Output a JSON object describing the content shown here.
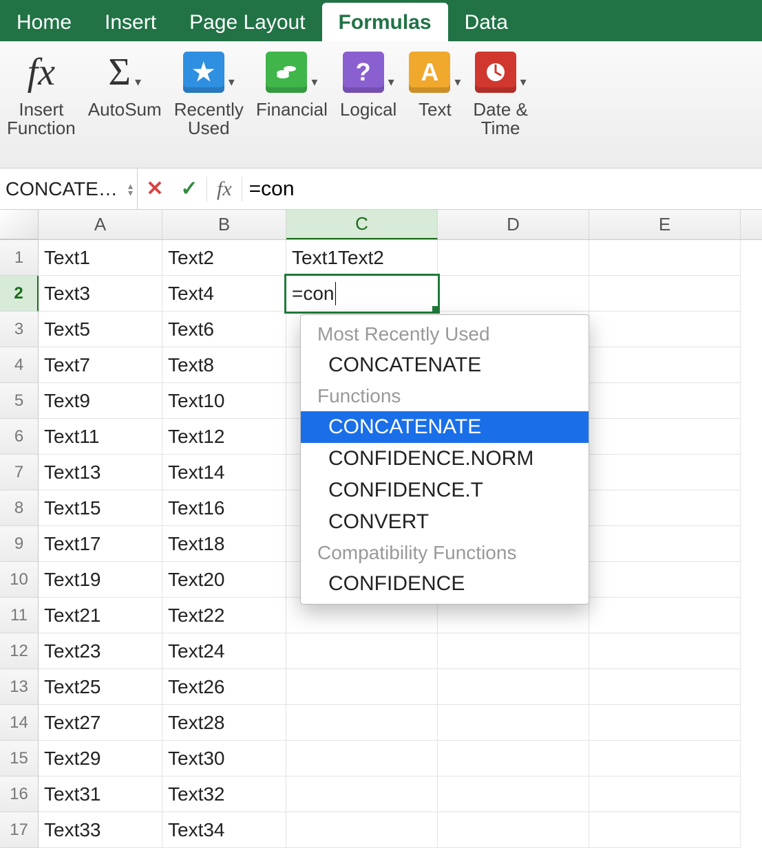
{
  "tabs": {
    "home": "Home",
    "insert": "Insert",
    "pageLayout": "Page Layout",
    "formulas": "Formulas",
    "data": "Data"
  },
  "ribbon": {
    "insertFunction": "Insert\nFunction",
    "autoSum": "AutoSum",
    "recentlyUsed": "Recently\nUsed",
    "financial": "Financial",
    "logical": "Logical",
    "text": "Text",
    "dateTime": "Date &\nTime"
  },
  "nameBox": "CONCATE…",
  "formulaInput": "=con",
  "columns": [
    "A",
    "B",
    "C",
    "D",
    "E"
  ],
  "rows": [
    {
      "n": "1",
      "a": "Text1",
      "b": "Text2",
      "c": "Text1Text2"
    },
    {
      "n": "2",
      "a": "Text3",
      "b": "Text4",
      "c": "=con"
    },
    {
      "n": "3",
      "a": "Text5",
      "b": "Text6",
      "c": ""
    },
    {
      "n": "4",
      "a": "Text7",
      "b": "Text8",
      "c": ""
    },
    {
      "n": "5",
      "a": "Text9",
      "b": "Text10",
      "c": ""
    },
    {
      "n": "6",
      "a": "Text11",
      "b": "Text12",
      "c": ""
    },
    {
      "n": "7",
      "a": "Text13",
      "b": "Text14",
      "c": ""
    },
    {
      "n": "8",
      "a": "Text15",
      "b": "Text16",
      "c": ""
    },
    {
      "n": "9",
      "a": "Text17",
      "b": "Text18",
      "c": ""
    },
    {
      "n": "10",
      "a": "Text19",
      "b": "Text20",
      "c": ""
    },
    {
      "n": "11",
      "a": "Text21",
      "b": "Text22",
      "c": ""
    },
    {
      "n": "12",
      "a": "Text23",
      "b": "Text24",
      "c": ""
    },
    {
      "n": "13",
      "a": "Text25",
      "b": "Text26",
      "c": ""
    },
    {
      "n": "14",
      "a": "Text27",
      "b": "Text28",
      "c": ""
    },
    {
      "n": "15",
      "a": "Text29",
      "b": "Text30",
      "c": ""
    },
    {
      "n": "16",
      "a": "Text31",
      "b": "Text32",
      "c": ""
    },
    {
      "n": "17",
      "a": "Text33",
      "b": "Text34",
      "c": ""
    }
  ],
  "autocomplete": {
    "groups": [
      {
        "header": "Most Recently Used",
        "items": [
          "CONCATENATE"
        ]
      },
      {
        "header": "Functions",
        "items": [
          "CONCATENATE",
          "CONFIDENCE.NORM",
          "CONFIDENCE.T",
          "CONVERT"
        ]
      },
      {
        "header": "Compatibility Functions",
        "items": [
          "CONFIDENCE"
        ]
      }
    ],
    "selected": "Functions:CONCATENATE"
  },
  "colors": {
    "recently": "#2f8fe0",
    "financial": "#3fb54a",
    "logical": "#8a5fcf",
    "text": "#f0a82d",
    "datetime": "#d0372e"
  }
}
